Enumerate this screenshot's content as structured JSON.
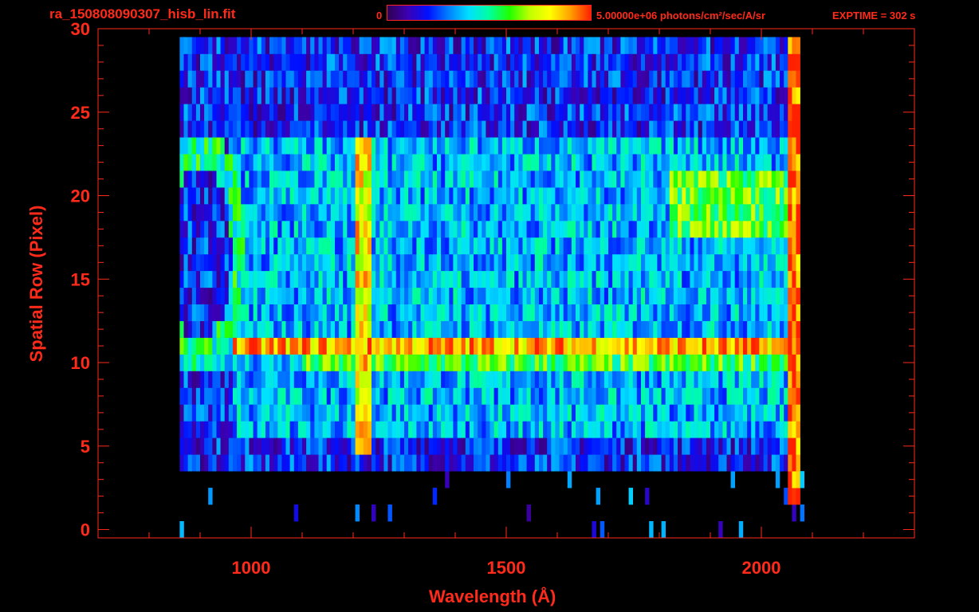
{
  "header": {
    "file_title": "ra_150808090307_hisb_lin.fit",
    "colorbar_min_label": "0",
    "colorbar_units_label": "5.00000e+06 photons/cm²/sec/A/sr",
    "exptime_label": "EXPTIME = 302 s"
  },
  "colors": {
    "text": "#ff2a1a",
    "axes": "#ff2a1a",
    "background": "#000000",
    "colormap": [
      "#000000",
      "#300050",
      "#3c00b4",
      "#0010ff",
      "#0080ff",
      "#00e0ff",
      "#00ffa0",
      "#20ff00",
      "#c0ff00",
      "#ffff00",
      "#ffa000",
      "#ff2000"
    ]
  },
  "chart_data": {
    "type": "heatmap",
    "xlabel": "Wavelength (Å)",
    "ylabel": "Spatial Row (Pixel)",
    "xlim": [
      700,
      2300
    ],
    "ylim": [
      -0.5,
      30
    ],
    "x_ticks": [
      1000,
      1500,
      2000
    ],
    "y_ticks": [
      0,
      5,
      10,
      15,
      20,
      25,
      30
    ],
    "x_minor_step": 100,
    "y_minor_step": 1,
    "colorbar_range": [
      0,
      5000000
    ],
    "data_x_extent": [
      860,
      2090
    ],
    "regions": [
      {
        "kind": "noise_background",
        "x": [
          860,
          2070
        ],
        "rows": [
          4,
          29
        ],
        "level": 0.28
      },
      {
        "kind": "diffuse_band",
        "x": [
          960,
          2065
        ],
        "rows": [
          6,
          23
        ],
        "level": 0.42
      },
      {
        "kind": "bright_row",
        "x": [
          960,
          2065
        ],
        "rows": [
          11,
          11
        ],
        "level": 0.88
      },
      {
        "kind": "bright_row",
        "x": [
          1100,
          2065
        ],
        "rows": [
          10,
          10
        ],
        "level": 0.62
      },
      {
        "kind": "bright_band",
        "x": [
          1820,
          2060
        ],
        "rows": [
          18,
          21
        ],
        "level": 0.65
      },
      {
        "kind": "emission_line",
        "x_center": 1216,
        "rows": [
          5,
          23
        ],
        "level": 0.82
      },
      {
        "kind": "emission_line",
        "x_center": 2060,
        "rows": [
          2,
          30
        ],
        "level": 0.95
      },
      {
        "kind": "arc_ring",
        "x_center": 895,
        "rows": [
          10,
          23
        ],
        "level": 0.55
      }
    ]
  }
}
